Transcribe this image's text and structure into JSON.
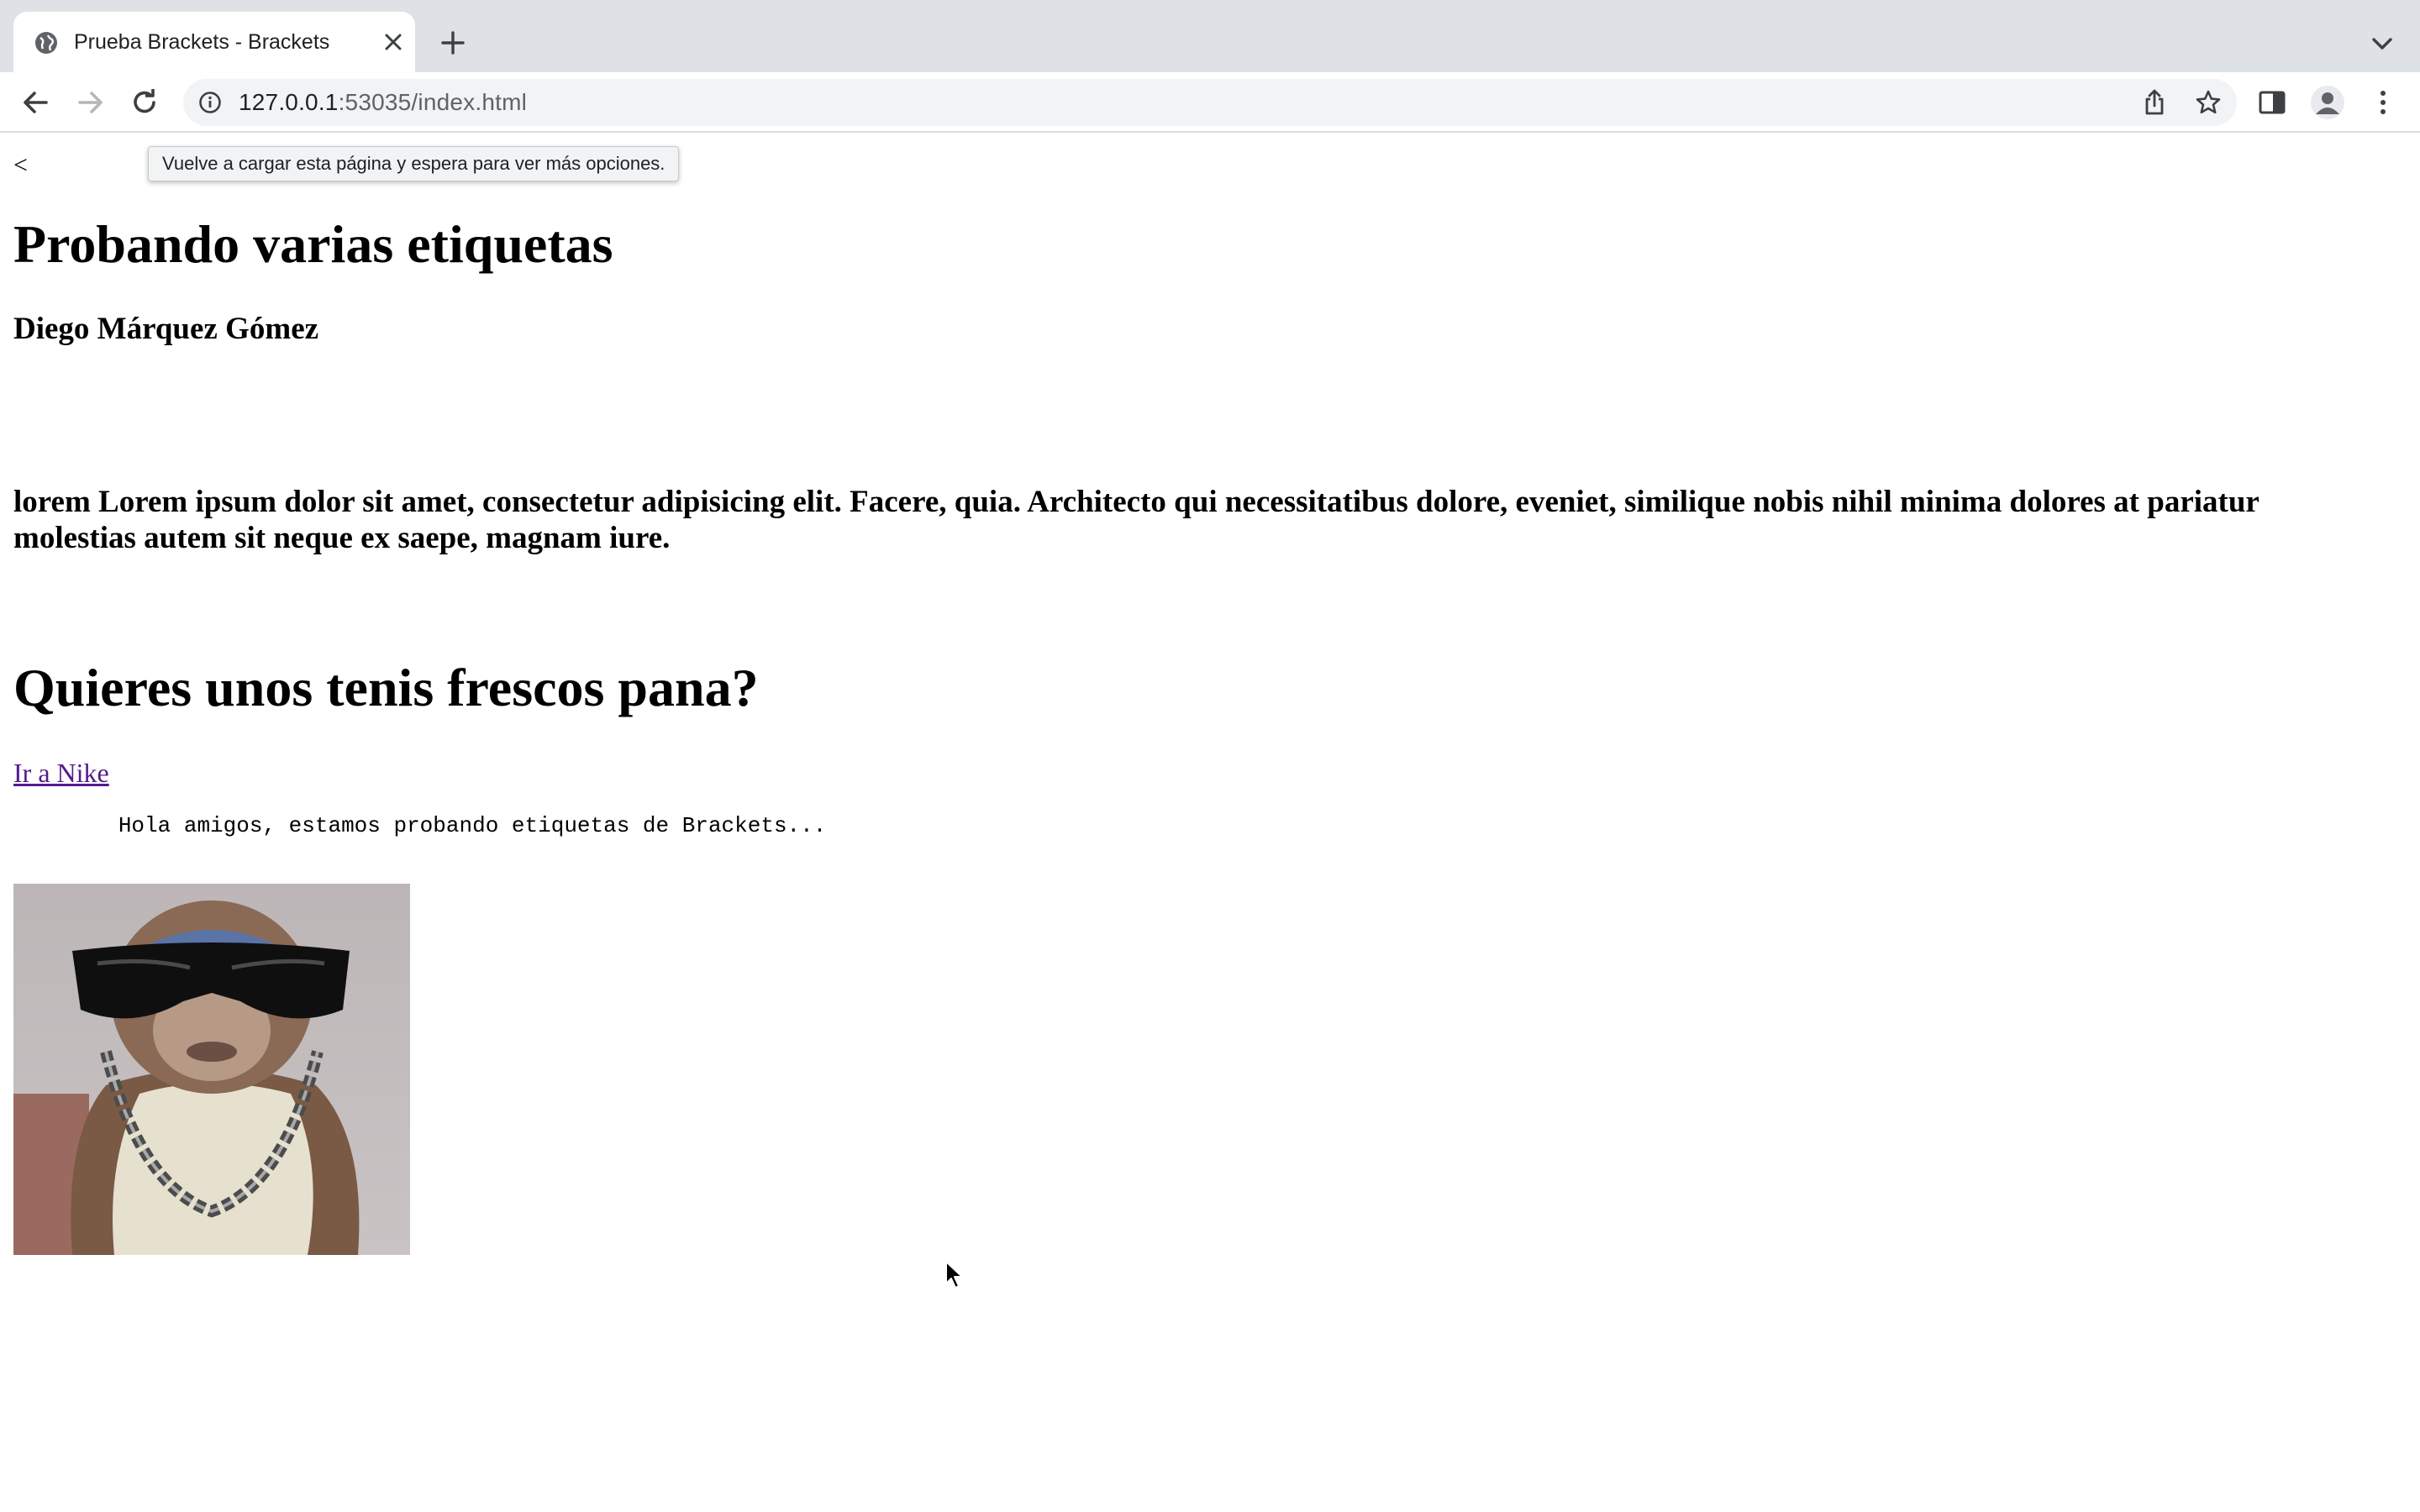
{
  "browser": {
    "tab": {
      "title": "Prueba Brackets - Brackets"
    },
    "address_bar": {
      "host": "127.0.0.1",
      "port_path": ":53035/index.html"
    },
    "tooltip": "Vuelve a cargar esta página y espera para ver más opciones."
  },
  "page": {
    "lt_text": "<",
    "heading1": "Probando varias etiquetas",
    "author": "Diego Márquez Gómez",
    "lorem": "lorem Lorem ipsum dolor sit amet, consectetur adipisicing elit. Facere, quia. Architecto qui necessitatibus dolore, eveniet, similique nobis nihil minima dolores at pariatur molestias autem sit neque ex saepe, magnam iure.",
    "heading2": "Quieres unos tenis frescos pana?",
    "link": "Ir a Nike",
    "pre_text": "\tHola amigos, estamos probando etiquetas de Brackets...",
    "image": "monkey-with-sunglasses-and-chain"
  },
  "colors": {
    "tabstrip_bg": "#dee1e6",
    "omnibox_bg": "#f1f3f4",
    "visited_link": "#551a8b"
  }
}
